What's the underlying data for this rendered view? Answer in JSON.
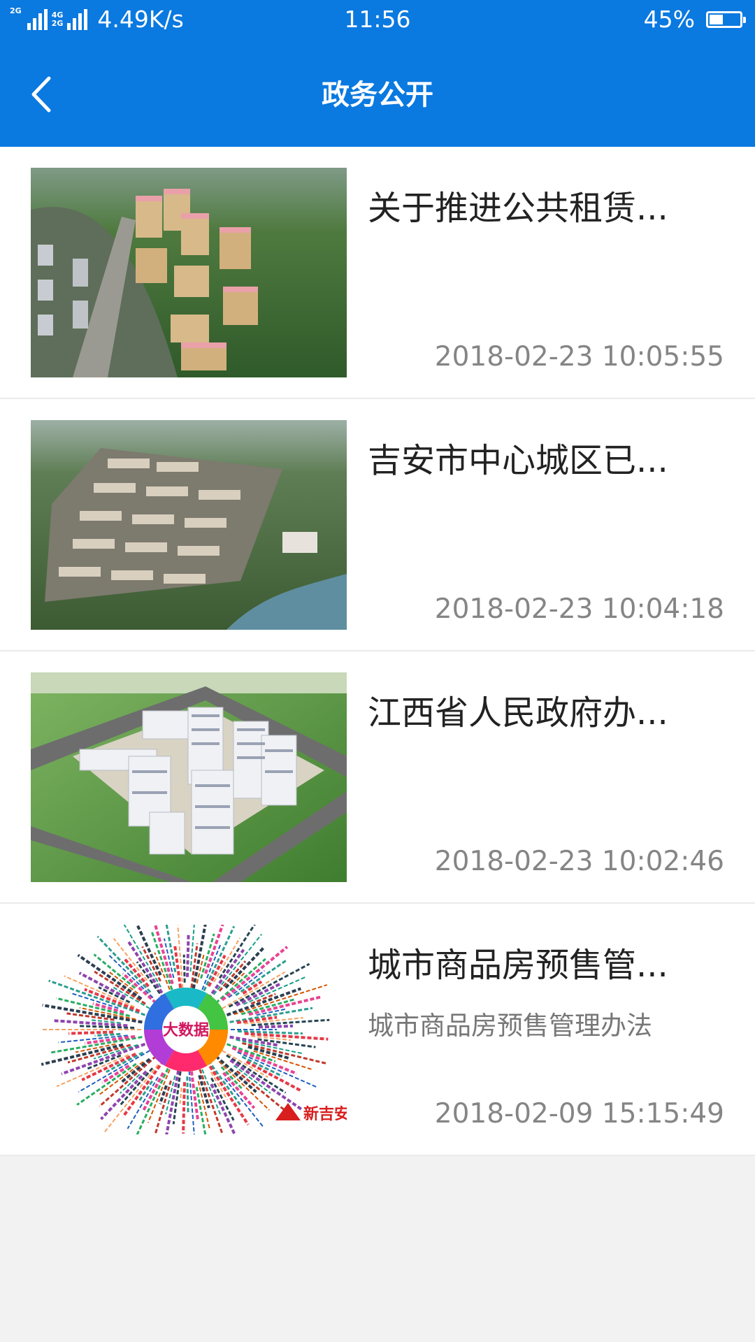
{
  "status_bar": {
    "network_top": "4G",
    "network_bottom": "2G",
    "network_tag": "2G",
    "speed": "4.49K/s",
    "time": "11:56",
    "battery_percent": "45%",
    "battery_level": 0.45
  },
  "nav": {
    "back_icon": "chevron-left-icon",
    "title": "政务公开"
  },
  "colors": {
    "primary": "#0a79e0",
    "background": "#f2f2f2",
    "title_text": "#222222",
    "meta_text": "#858585"
  },
  "articles": [
    {
      "title": "关于推进公共租赁...",
      "subtitle": "",
      "date": "2018-02-23 10:05:55",
      "thumbnail": "aerial-render-high-rise-residential"
    },
    {
      "title": "吉安市中心城区已...",
      "subtitle": "",
      "date": "2018-02-23 10:04:18",
      "thumbnail": "aerial-render-low-rise-community"
    },
    {
      "title": "江西省人民政府办...",
      "subtitle": "",
      "date": "2018-02-23 10:02:46",
      "thumbnail": "aerial-render-apartment-complex"
    },
    {
      "title": "城市商品房预售管...",
      "subtitle": "城市商品房预售管理办法",
      "date": "2018-02-09 15:15:49",
      "thumbnail": "big-data-logo-cloud",
      "thumb_center_text": "大数据",
      "thumb_brand_text": "新吉安"
    }
  ]
}
